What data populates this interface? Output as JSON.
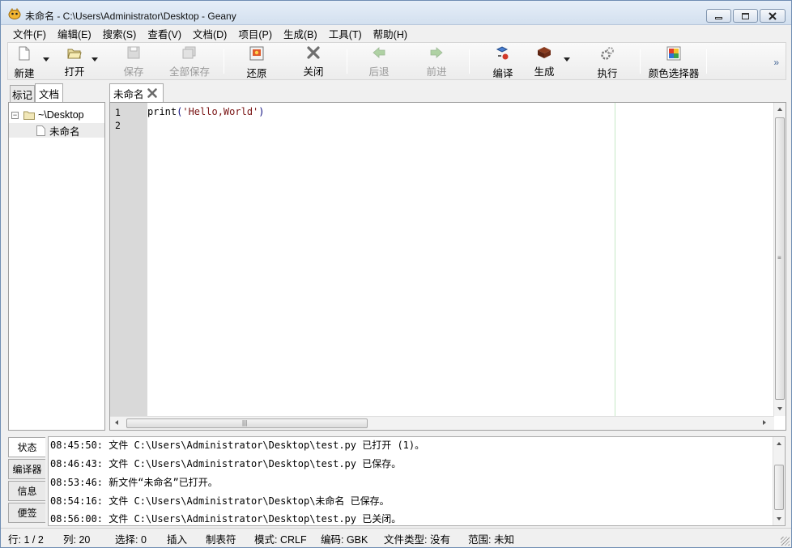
{
  "window": {
    "title": "未命名 - C:\\Users\\Administrator\\Desktop - Geany"
  },
  "menu": [
    "文件(F)",
    "编辑(E)",
    "搜索(S)",
    "查看(V)",
    "文档(D)",
    "项目(P)",
    "生成(B)",
    "工具(T)",
    "帮助(H)"
  ],
  "toolbar": {
    "new": "新建",
    "open": "打开",
    "save": "保存",
    "save_all": "全部保存",
    "revert": "还原",
    "close": "关闭",
    "back": "后退",
    "forward": "前进",
    "compile": "编译",
    "build": "生成",
    "run": "执行",
    "color_picker": "颜色选择器",
    "overflow": "»"
  },
  "sidebar": {
    "tabs": [
      "标记",
      "文档"
    ],
    "active_tab": "文档",
    "tree": {
      "folder": "~\\Desktop",
      "file": "未命名"
    }
  },
  "editor": {
    "tab_label": "未命名",
    "line_numbers": [
      "1",
      "2"
    ],
    "code": {
      "fn": "print",
      "open": "(",
      "str": "'Hello,World'",
      "close": ")"
    }
  },
  "messages": {
    "tabs": [
      "状态",
      "编译器",
      "信息",
      "便签"
    ],
    "active_tab": "状态",
    "lines": [
      "08:45:50: 文件 C:\\Users\\Administrator\\Desktop\\test.py 已打开 (1)。",
      "08:46:43: 文件 C:\\Users\\Administrator\\Desktop\\test.py 已保存。",
      "08:53:46: 新文件“未命名”已打开。",
      "08:54:16: 文件 C:\\Users\\Administrator\\Desktop\\未命名 已保存。",
      "08:56:00: 文件 C:\\Users\\Administrator\\Desktop\\test.py 已关闭。"
    ]
  },
  "status": {
    "line": "行: 1 / 2",
    "col": "列: 20",
    "sel": "选择: 0",
    "mode_insert": "插入",
    "tabs": "制表符",
    "eol": "模式: CRLF",
    "encoding": "编码: GBK",
    "filetype": "文件类型: 没有",
    "scope": "范围: 未知"
  },
  "colors": {
    "gutter": "#d9d9d9",
    "long_line_marker": "#c7e8c7",
    "string": "#7a1515"
  }
}
